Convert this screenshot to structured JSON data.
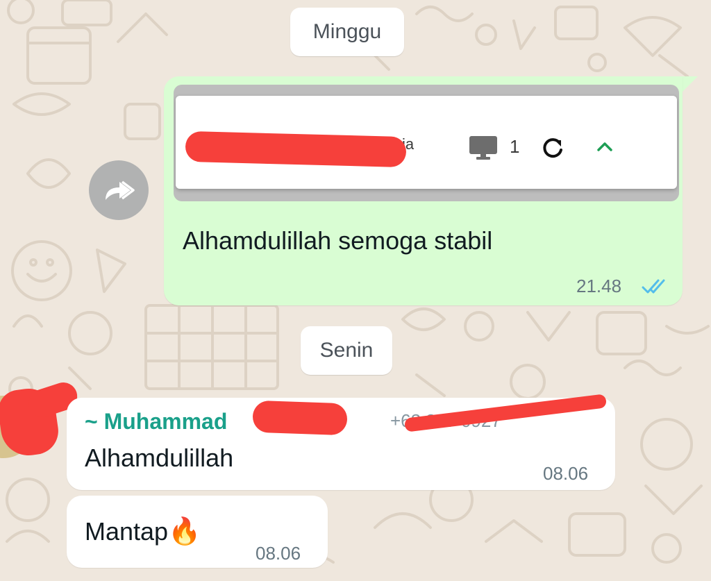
{
  "date_separators": {
    "first": "Minggu",
    "second": "Senin"
  },
  "outgoing": {
    "preview": {
      "obscured_text_tail": "ia",
      "device_count": "1",
      "monitor_icon": "monitor-icon",
      "refresh_icon": "refresh-icon",
      "collapse_icon": "chevron-up-icon"
    },
    "text": "Alhamdulillah semoga stabil",
    "time": "21.48",
    "status_icon": "double-check-read-icon",
    "colors": {
      "bubble": "#d9fdd3",
      "read_ticks": "#53bdeb"
    }
  },
  "incoming": [
    {
      "sender_name": "~ Muhammad",
      "sender_name_tail": "...",
      "sender_phone": "+62 857 0927",
      "text": "Alhamdulillah",
      "time": "08.06"
    },
    {
      "text": "Mantap",
      "emoji": "🔥",
      "time": "08.06"
    }
  ],
  "colors": {
    "sender_name": "#1aa08a",
    "chat_background": "#efe7dd",
    "redaction": "#f6403b"
  }
}
